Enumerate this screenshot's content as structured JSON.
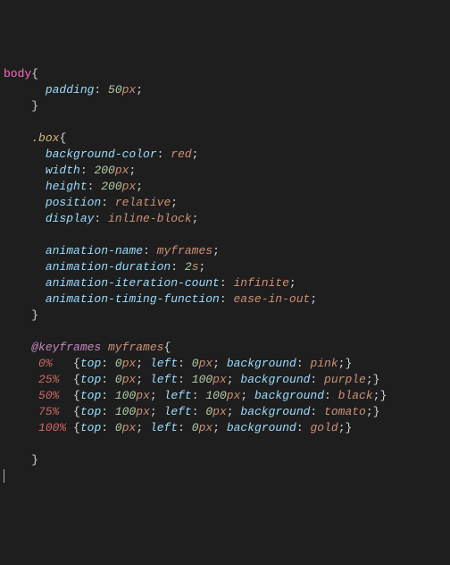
{
  "code": {
    "selector_body": "body",
    "body_rules": [
      {
        "prop": "padding",
        "num": "50",
        "unit": "px"
      }
    ],
    "selector_box": ".box",
    "box_rules_block1": [
      {
        "prop": "background-color",
        "val": "red"
      },
      {
        "prop": "width",
        "num": "200",
        "unit": "px"
      },
      {
        "prop": "height",
        "num": "200",
        "unit": "px"
      },
      {
        "prop": "position",
        "val": "relative"
      },
      {
        "prop": "display",
        "val": "inline-block"
      }
    ],
    "box_rules_block2": [
      {
        "prop": "animation-name",
        "val": "myframes"
      },
      {
        "prop": "animation-duration",
        "num": "2",
        "unit": "s"
      },
      {
        "prop": "animation-iteration-count",
        "val": "infinite"
      },
      {
        "prop": "animation-timing-function",
        "val": "ease-in-out"
      }
    ],
    "keyframes_kw": "@keyframes",
    "keyframes_name": "myframes",
    "frames": [
      {
        "pct": "0%",
        "pad": "   ",
        "top": "0",
        "left": "0",
        "bg": "pink"
      },
      {
        "pct": "25%",
        "pad": "  ",
        "top": "0",
        "left": "100",
        "bg": "purple"
      },
      {
        "pct": "50%",
        "pad": "  ",
        "top": "100",
        "left": "100",
        "bg": "black"
      },
      {
        "pct": "75%",
        "pad": "  ",
        "top": "100",
        "left": "0",
        "bg": "tomato"
      },
      {
        "pct": "100%",
        "pad": " ",
        "top": "0",
        "left": "0",
        "bg": "gold"
      }
    ],
    "props": {
      "top": "top",
      "left": "left",
      "background": "background"
    },
    "unit_px": "px"
  }
}
